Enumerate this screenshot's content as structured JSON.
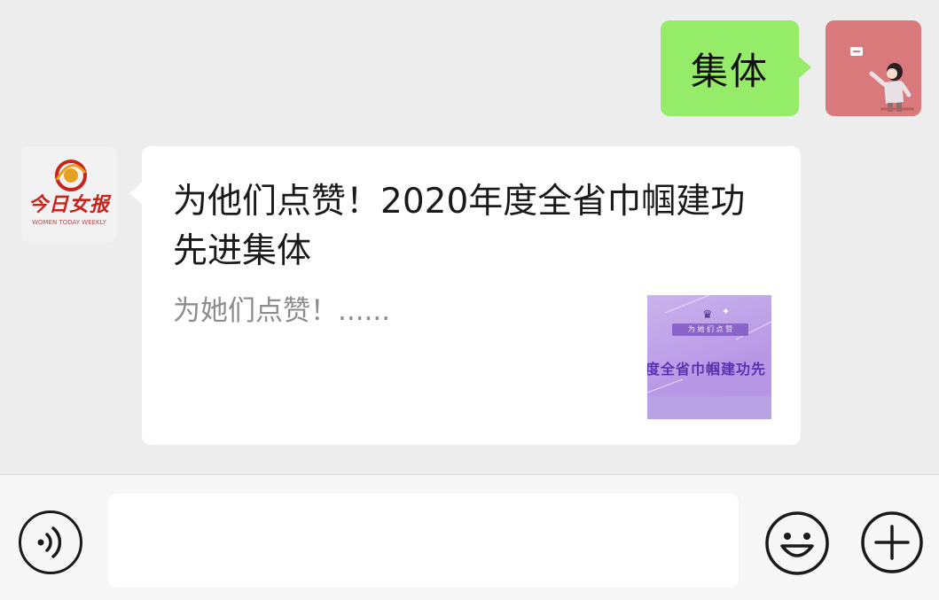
{
  "outgoing_message": {
    "text": "集体"
  },
  "incoming_message": {
    "sender_logo": {
      "name": "今日女报",
      "subtitle": "WOMEN TODAY WEEKLY"
    },
    "article": {
      "title": "为他们点赞！2020年度全省巾帼建功先进集体",
      "description": "为她们点赞！......",
      "thumbnail": {
        "banner": "为 她 们 点 赞",
        "headline": "度全省巾帼建功先"
      }
    }
  },
  "input_bar": {
    "text_value": ""
  },
  "colors": {
    "chat_background": "#ededed",
    "outgoing_bubble": "#95ec69",
    "incoming_bubble": "#ffffff",
    "logo_red": "#c8241c",
    "thumbnail_purple": "#b898e6"
  },
  "icons": {
    "voice": "voice-icon",
    "emoji": "emoji-icon",
    "plus": "plus-icon"
  }
}
